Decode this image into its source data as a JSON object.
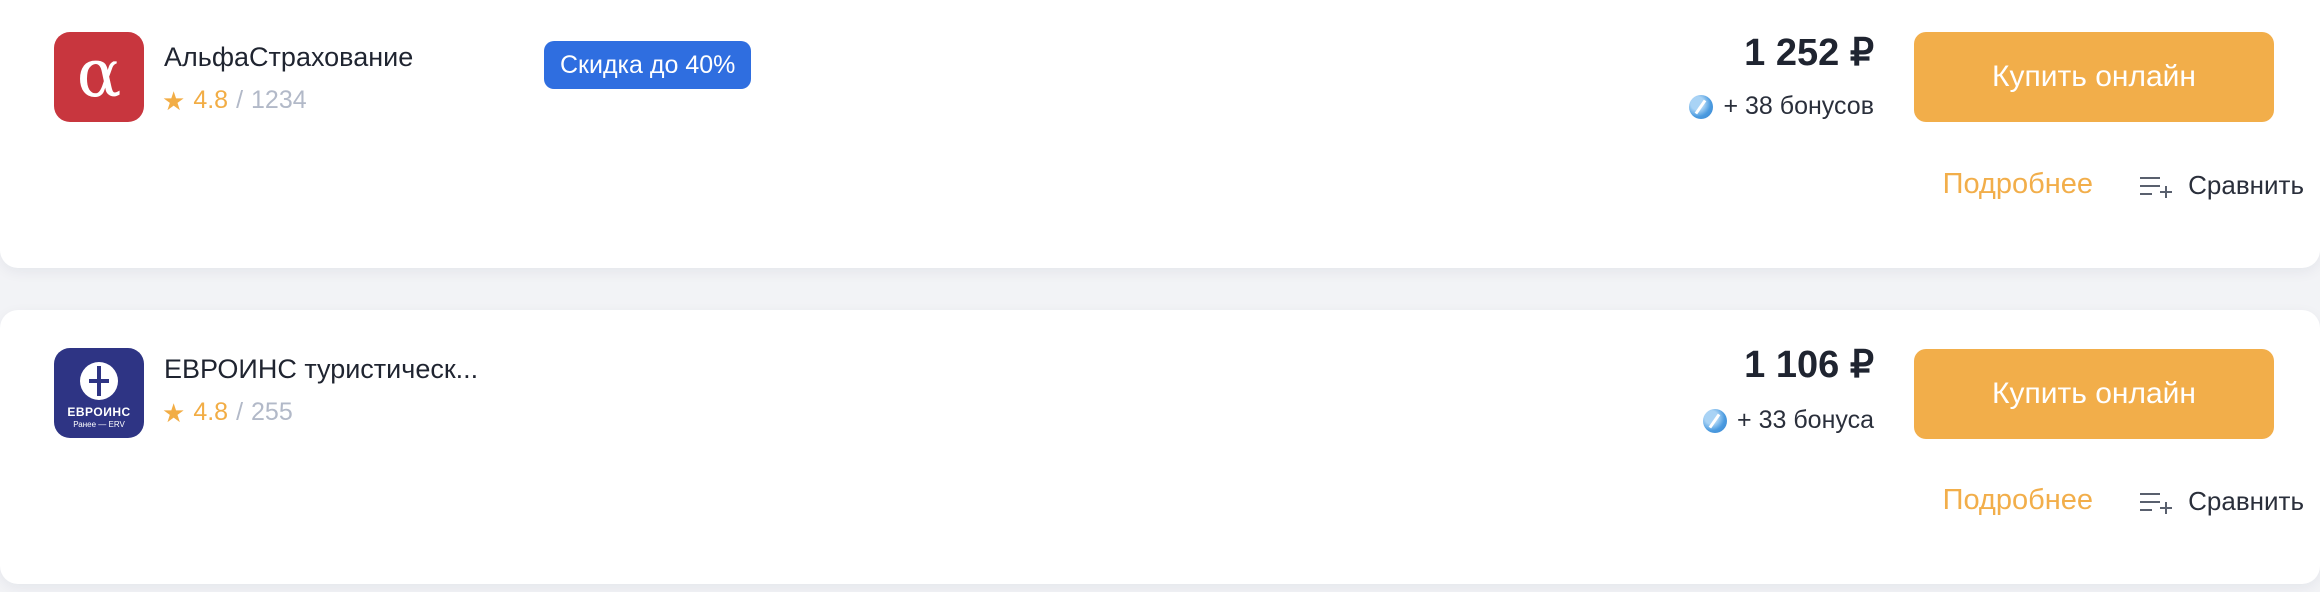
{
  "offers": [
    {
      "company": "АльфаСтрахование",
      "logo_glyph": "α",
      "logo_color": "#c8363e",
      "rating": "4.8",
      "rating_separator": "/",
      "reviews": "1234",
      "discount_badge": "Скидка до 40%",
      "price": "1 252 ₽",
      "bonus": "+ 38 бонусов",
      "buy_label": "Купить онлайн",
      "details_label": "Подробнее",
      "compare_label": "Сравнить"
    },
    {
      "company": "ЕВРОИНС туристическ...",
      "logo_name": "ЕВРОИНС",
      "logo_sub": "Ранее — ERV",
      "logo_color": "#2e3484",
      "rating": "4.8",
      "rating_separator": "/",
      "reviews": "255",
      "price": "1 106 ₽",
      "bonus": "+ 33 бонуса",
      "buy_label": "Купить онлайн",
      "details_label": "Подробнее",
      "compare_label": "Сравнить"
    }
  ],
  "colors": {
    "accent": "#f2ae4a",
    "discount": "#2f6ee0",
    "rating": "#f2ad45",
    "muted": "#b2b9c8"
  },
  "icons": {
    "star": "star-icon",
    "bonus": "bonus-coin-icon",
    "compare": "compare-list-add-icon"
  }
}
